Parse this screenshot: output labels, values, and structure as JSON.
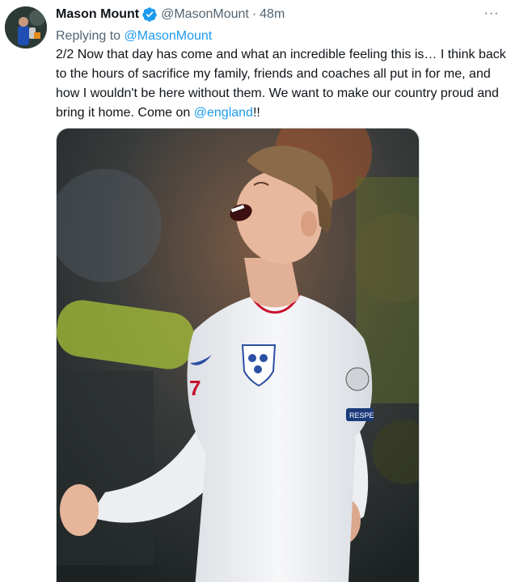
{
  "author": {
    "name": "Mason Mount",
    "handle": "@MasonMount",
    "separator": "·",
    "time": "48m",
    "verified": true,
    "avatar_icon": "profile-photo"
  },
  "more_label": "···",
  "replying": {
    "prefix": "Replying to ",
    "handle": "@MasonMount"
  },
  "tweet": {
    "text_before": "2/2 Now that day has come and what an incredible feeling this is… I think back to the hours of sacrifice my family, friends and coaches all put in for me, and how I wouldn't be here without them. We want to make our country proud and bring it home. Come on ",
    "mention": "@england",
    "text_after": "!!"
  },
  "media": {
    "type": "photo",
    "icon": "celebrating-player-photo",
    "shirt_number": "7",
    "sleeve_text": "RESPE",
    "colors": {
      "shirt": "#f2f3f5",
      "accent_red": "#c8102e",
      "badge_blue": "#2b4fa3"
    }
  },
  "colors": {
    "link": "#1d9bf0",
    "secondary_text": "#536471",
    "verified": "#1d9bf0"
  }
}
